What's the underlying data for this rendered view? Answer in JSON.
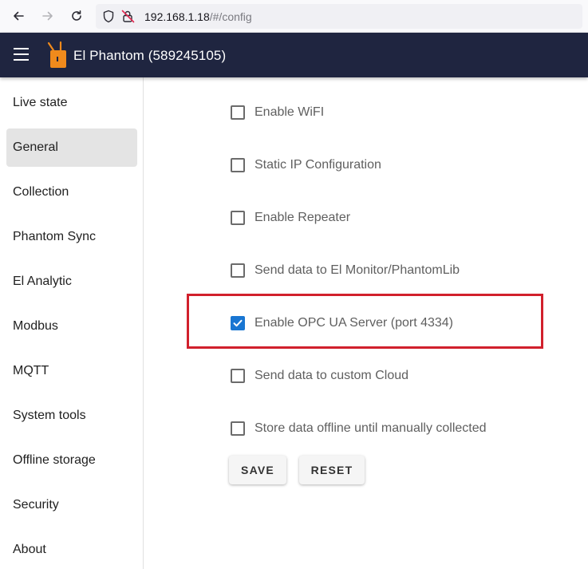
{
  "browser": {
    "url_host": "192.168.1.18",
    "url_path": "/#/config"
  },
  "header": {
    "title": "El Phantom (589245105)",
    "logo_color": "#f08a1c",
    "bar_color": "#1f2540"
  },
  "sidebar": {
    "items": [
      {
        "label": "Live state",
        "active": false
      },
      {
        "label": "General",
        "active": true
      },
      {
        "label": "Collection",
        "active": false
      },
      {
        "label": "Phantom Sync",
        "active": false
      },
      {
        "label": "El Analytic",
        "active": false
      },
      {
        "label": "Modbus",
        "active": false
      },
      {
        "label": "MQTT",
        "active": false
      },
      {
        "label": "System tools",
        "active": false
      },
      {
        "label": "Offline storage",
        "active": false
      },
      {
        "label": "Security",
        "active": false
      },
      {
        "label": "About",
        "active": false
      }
    ]
  },
  "options": [
    {
      "label": "Enable WiFI",
      "checked": false
    },
    {
      "label": "Static IP Configuration",
      "checked": false
    },
    {
      "label": "Enable Repeater",
      "checked": false
    },
    {
      "label": "Send data to El Monitor/PhantomLib",
      "checked": false
    },
    {
      "label": "Enable OPC UA Server (port 4334)",
      "checked": true
    },
    {
      "label": "Send data to custom Cloud",
      "checked": false
    },
    {
      "label": "Store data offline until manually collected",
      "checked": false
    }
  ],
  "actions": {
    "save_label": "SAVE",
    "reset_label": "RESET"
  },
  "colors": {
    "checkbox_checked": "#1976d2",
    "highlight_border": "#d1202c"
  }
}
